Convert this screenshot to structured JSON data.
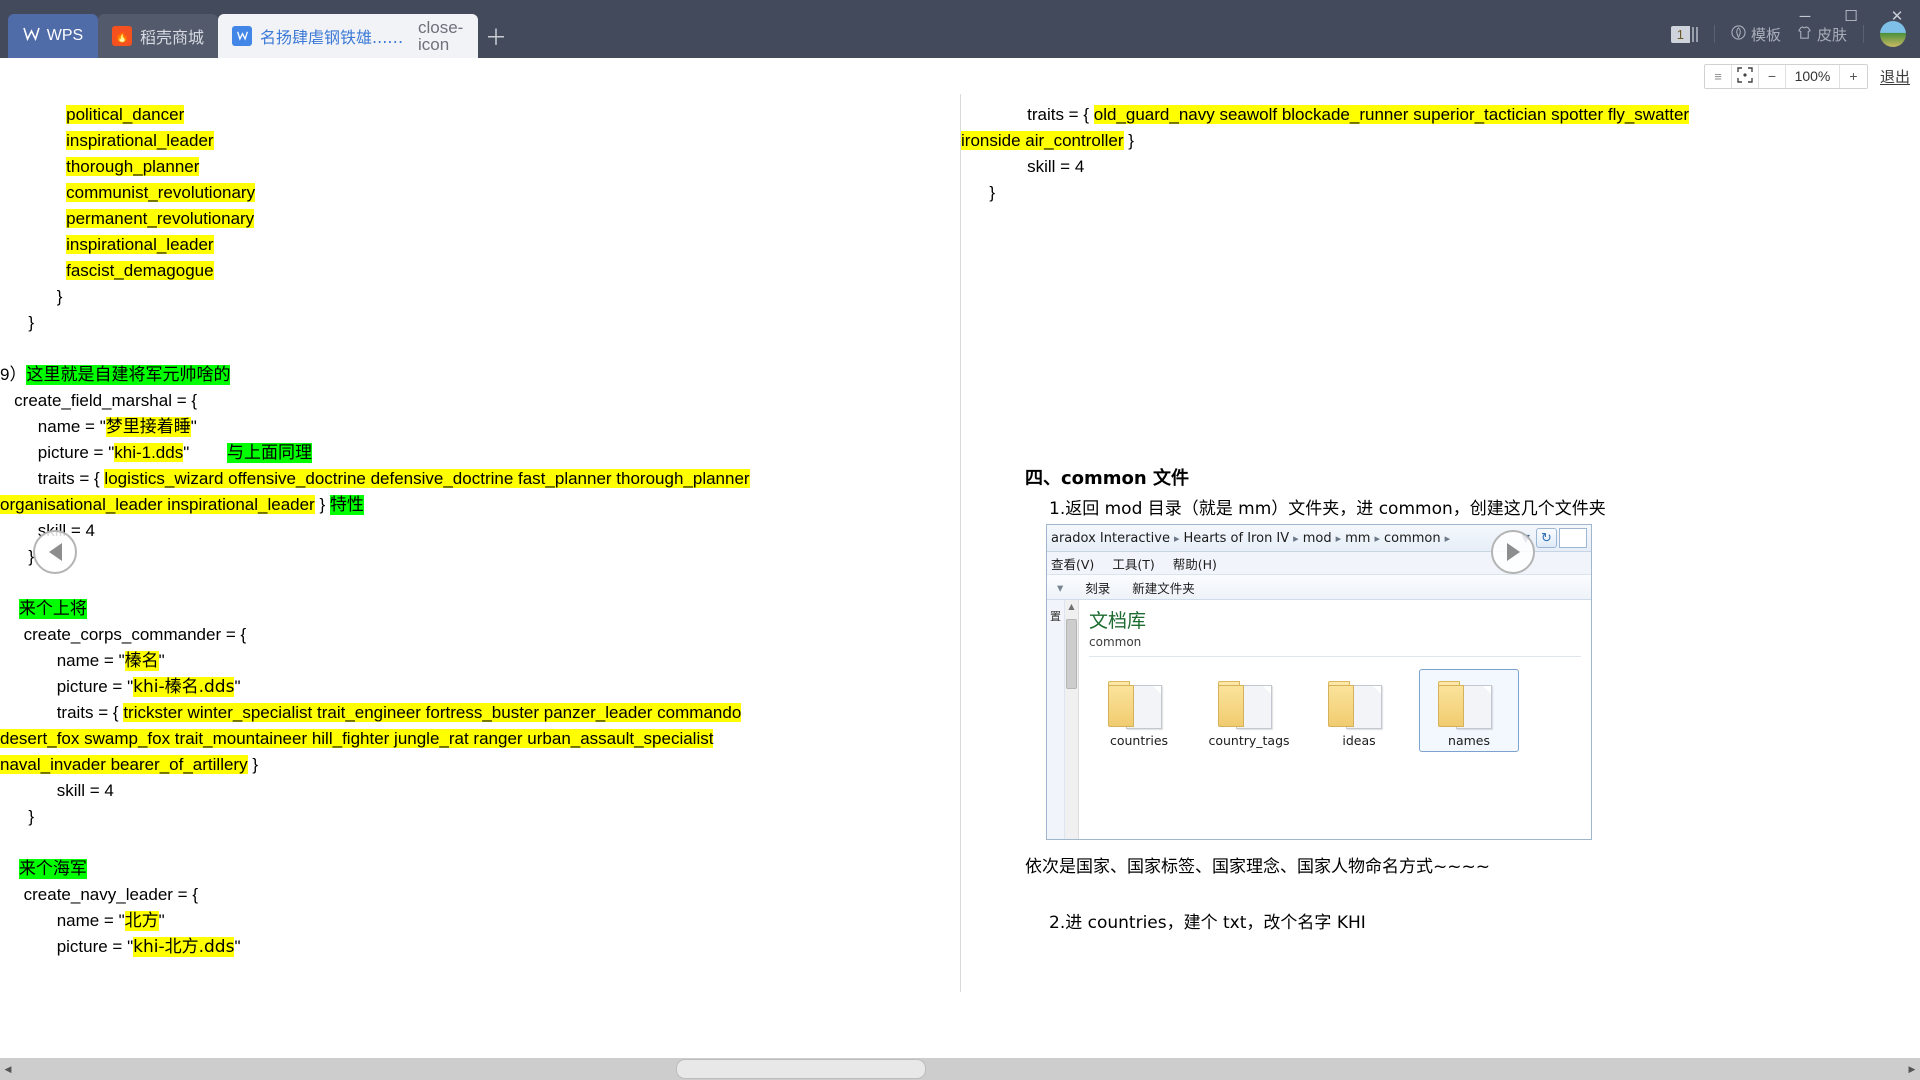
{
  "titlebar": {
    "home_label": "WPS",
    "home_icon": "wps-logo-icon",
    "tabs": [
      {
        "label": "稻壳商城",
        "favicon": "rice-husk-store-icon",
        "active": false
      },
      {
        "label": "名扬肆虐钢铁雄...制作新人友好型",
        "favicon": "wps-doc-icon",
        "active": true
      }
    ],
    "new_tab_icon": "plus-icon",
    "close_tab_icon": "close-icon",
    "page_count": "1",
    "template_label": "模板",
    "skin_label": "皮肤",
    "template_icon": "template-icon",
    "skin_icon": "tshirt-icon",
    "avatar": "user-avatar",
    "window": {
      "minimize": "─",
      "maximize": "☐",
      "close": "✕"
    }
  },
  "reader_toolbar": {
    "grip_icon": "grip-handle-icon",
    "fit_icon": "fit-screen-icon",
    "zoom_out": "−",
    "zoom_value": "100%",
    "zoom_in": "+",
    "exit_label": "退出"
  },
  "nav": {
    "prev_icon": "prev-page-arrow-icon",
    "next_icon": "next-page-arrow-icon"
  },
  "page_left": {
    "lines": [
      {
        "segments": [
          {
            "t": "              ",
            "s": "plain"
          },
          {
            "t": "political_dancer",
            "s": "hl-y"
          }
        ]
      },
      {
        "segments": [
          {
            "t": "              ",
            "s": "plain"
          },
          {
            "t": "inspirational_leader",
            "s": "hl-y"
          }
        ]
      },
      {
        "segments": [
          {
            "t": "              ",
            "s": "plain"
          },
          {
            "t": "thorough_planner",
            "s": "hl-y"
          }
        ]
      },
      {
        "segments": [
          {
            "t": "              ",
            "s": "plain"
          },
          {
            "t": "communist_revolutionary",
            "s": "hl-y"
          }
        ]
      },
      {
        "segments": [
          {
            "t": "              ",
            "s": "plain"
          },
          {
            "t": "permanent_revolutionary",
            "s": "hl-y"
          }
        ]
      },
      {
        "segments": [
          {
            "t": "              ",
            "s": "plain"
          },
          {
            "t": "inspirational_leader",
            "s": "hl-y"
          }
        ]
      },
      {
        "segments": [
          {
            "t": "              ",
            "s": "plain"
          },
          {
            "t": "fascist_demagogue",
            "s": "hl-y"
          }
        ]
      },
      {
        "segments": [
          {
            "t": "            }",
            "s": "plain"
          }
        ]
      },
      {
        "segments": [
          {
            "t": "      }",
            "s": "plain"
          }
        ]
      },
      {
        "segments": [
          {
            "t": "",
            "s": "plain"
          }
        ]
      },
      {
        "segments": [
          {
            "t": "9）",
            "s": "plain"
          },
          {
            "t": "这里就是自建将军元帅啥的",
            "s": "hl-g cn"
          }
        ]
      },
      {
        "segments": [
          {
            "t": "   create_field_marshal = {",
            "s": "plain"
          }
        ]
      },
      {
        "segments": [
          {
            "t": "        name = \"",
            "s": "plain"
          },
          {
            "t": "梦里接着睡",
            "s": "hl-y cn"
          },
          {
            "t": "\"",
            "s": "plain"
          }
        ]
      },
      {
        "segments": [
          {
            "t": "        picture = \"",
            "s": "plain"
          },
          {
            "t": "khi-1.dds",
            "s": "hl-y"
          },
          {
            "t": "\"        ",
            "s": "plain"
          },
          {
            "t": "与上面同理",
            "s": "hl-g cn"
          }
        ]
      },
      {
        "segments": [
          {
            "t": "        traits = { ",
            "s": "plain"
          },
          {
            "t": "logistics_wizard offensive_doctrine defensive_doctrine fast_planner thorough_planner",
            "s": "hl-y"
          }
        ]
      },
      {
        "segments": [
          {
            "t": "organisational_leader inspirational_leader",
            "s": "hl-y"
          },
          {
            "t": " } ",
            "s": "plain"
          },
          {
            "t": "特性",
            "s": "hl-g cn"
          }
        ]
      },
      {
        "segments": [
          {
            "t": "        skill = 4",
            "s": "plain"
          }
        ]
      },
      {
        "segments": [
          {
            "t": "      }",
            "s": "plain"
          }
        ]
      },
      {
        "segments": [
          {
            "t": "",
            "s": "plain"
          }
        ]
      },
      {
        "segments": [
          {
            "t": "    ",
            "s": "plain"
          },
          {
            "t": "来个上将",
            "s": "hl-g cn"
          }
        ]
      },
      {
        "segments": [
          {
            "t": "     create_corps_commander = {",
            "s": "plain"
          }
        ]
      },
      {
        "segments": [
          {
            "t": "            name = \"",
            "s": "plain"
          },
          {
            "t": "榛名",
            "s": "hl-y cn"
          },
          {
            "t": "\"",
            "s": "plain"
          }
        ]
      },
      {
        "segments": [
          {
            "t": "            picture = \"",
            "s": "plain"
          },
          {
            "t": "khi-榛名.dds",
            "s": "hl-y cn"
          },
          {
            "t": "\"",
            "s": "plain"
          }
        ]
      },
      {
        "segments": [
          {
            "t": "            traits = { ",
            "s": "plain"
          },
          {
            "t": "trickster winter_specialist trait_engineer fortress_buster panzer_leader commando",
            "s": "hl-y"
          }
        ]
      },
      {
        "segments": [
          {
            "t": "desert_fox swamp_fox trait_mountaineer hill_fighter jungle_rat ranger urban_assault_specialist",
            "s": "hl-y"
          }
        ]
      },
      {
        "segments": [
          {
            "t": "naval_invader bearer_of_artillery",
            "s": "hl-y"
          },
          {
            "t": " }",
            "s": "plain"
          }
        ]
      },
      {
        "segments": [
          {
            "t": "            skill = 4",
            "s": "plain"
          }
        ]
      },
      {
        "segments": [
          {
            "t": "      }",
            "s": "plain"
          }
        ]
      },
      {
        "segments": [
          {
            "t": "",
            "s": "plain"
          }
        ]
      },
      {
        "segments": [
          {
            "t": "    ",
            "s": "plain"
          },
          {
            "t": "来个海军",
            "s": "hl-g cn"
          }
        ]
      },
      {
        "segments": [
          {
            "t": "     create_navy_leader = {",
            "s": "plain"
          }
        ]
      },
      {
        "segments": [
          {
            "t": "            name = \"",
            "s": "plain"
          },
          {
            "t": "北方",
            "s": "hl-y cn"
          },
          {
            "t": "\"",
            "s": "plain"
          }
        ]
      },
      {
        "segments": [
          {
            "t": "            picture = \"",
            "s": "plain"
          },
          {
            "t": "khi-北方.dds",
            "s": "hl-y cn"
          },
          {
            "t": "\"",
            "s": "plain"
          }
        ]
      }
    ]
  },
  "page_right": {
    "lines": [
      {
        "segments": [
          {
            "t": "              traits = { ",
            "s": "plain"
          },
          {
            "t": "old_guard_navy seawolf blockade_runner superior_tactician spotter fly_swatter",
            "s": "hl-y"
          }
        ]
      },
      {
        "segments": [
          {
            "t": "ironside air_controller",
            "s": "hl-y"
          },
          {
            "t": " }",
            "s": "plain"
          }
        ]
      },
      {
        "segments": [
          {
            "t": "              skill = 4",
            "s": "plain"
          }
        ]
      },
      {
        "segments": [
          {
            "t": "      }",
            "s": "plain"
          }
        ]
      }
    ],
    "heading": "四、common 文件",
    "step1": "1.返回 mod 目录（就是 mm）文件夹，进 common，创建这几个文件夹",
    "caption": "依次是国家、国家标签、国家理念、国家人物命名方式~~~~",
    "step2": "2.进 countries，建个 txt，改个名字 KHI"
  },
  "explorer": {
    "breadcrumbs": [
      "aradox Interactive",
      "Hearts of Iron IV",
      "mod",
      "mm",
      "common"
    ],
    "breadcrumb_sep": "▸",
    "dropdown_icon": "chevron-down-icon",
    "refresh_icon": "refresh-icon",
    "menus": [
      "查看(V)",
      "工具(T)",
      "帮助(H)"
    ],
    "toolbar_items": [
      "刻录",
      "新建文件夹"
    ],
    "sidebar_text": "置",
    "library_title": "文档库",
    "library_sub": "common",
    "folders": [
      {
        "label": "countries",
        "selected": false
      },
      {
        "label": "country_tags",
        "selected": false
      },
      {
        "label": "ideas",
        "selected": false
      },
      {
        "label": "names",
        "selected": true
      }
    ]
  },
  "hscroll": {
    "left_icon": "◀",
    "right_icon": "▶"
  }
}
